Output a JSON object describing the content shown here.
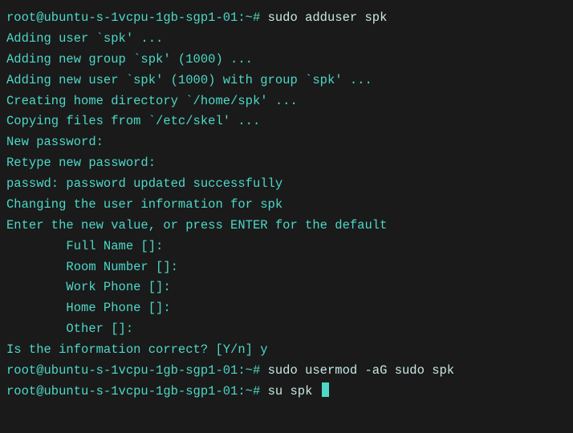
{
  "lines": [
    {
      "prompt": "root@ubuntu-s-1vcpu-1gb-sgp1-01:~#",
      "command": " sudo adduser spk"
    },
    {
      "output": "Adding user `spk' ..."
    },
    {
      "output": "Adding new group `spk' (1000) ..."
    },
    {
      "output": "Adding new user `spk' (1000) with group `spk' ..."
    },
    {
      "output": "Creating home directory `/home/spk' ..."
    },
    {
      "output": "Copying files from `/etc/skel' ..."
    },
    {
      "output": "New password:"
    },
    {
      "output": "Retype new password:"
    },
    {
      "output": "passwd: password updated successfully"
    },
    {
      "output": "Changing the user information for spk"
    },
    {
      "output": "Enter the new value, or press ENTER for the default"
    },
    {
      "output": "        Full Name []:"
    },
    {
      "output": "        Room Number []:"
    },
    {
      "output": "        Work Phone []:"
    },
    {
      "output": "        Home Phone []:"
    },
    {
      "output": "        Other []:"
    },
    {
      "output": "Is the information correct? [Y/n] y"
    },
    {
      "prompt": "root@ubuntu-s-1vcpu-1gb-sgp1-01:~#",
      "command": " sudo usermod -aG sudo spk"
    },
    {
      "prompt": "root@ubuntu-s-1vcpu-1gb-sgp1-01:~#",
      "command": " su spk ",
      "cursor": true
    }
  ]
}
